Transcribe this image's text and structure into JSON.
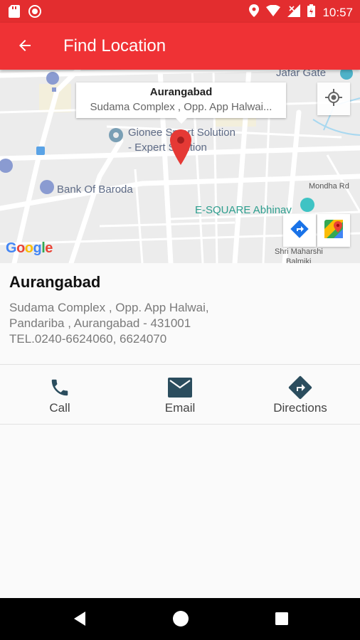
{
  "status_bar": {
    "time": "10:57",
    "left_icons": [
      "sd-card-icon",
      "record-icon"
    ],
    "right_icons": [
      "location-icon",
      "wifi-icon",
      "signal-icon",
      "battery-icon"
    ]
  },
  "app_bar": {
    "title": "Find Location",
    "back_icon": "arrow-back-icon",
    "color": "#ef3235"
  },
  "map": {
    "info_window": {
      "title": "Aurangabad",
      "subtitle": "Sudama Complex , Opp. App Halwai..."
    },
    "labels": {
      "jafar_gate": "Jafar Gate",
      "gionee_1": "Gionee Smart Solution",
      "gionee_2": "- Expert Solution",
      "bank": "Bank Of Baroda",
      "mondha": "Mondha Rd",
      "esquare": "E-SQUARE Abhinav",
      "shri_1": "Shri Maharshi",
      "shri_2": "Balmiki"
    },
    "logo": "Google",
    "marker_color": "#e53935"
  },
  "location": {
    "name": "Aurangabad",
    "address_line1": "Sudama Complex , Opp. App Halwai,",
    "address_line2": "Pandariba , Aurangabad - 431001",
    "phone_line": "TEL.0240-6624060, 6624070"
  },
  "actions": [
    {
      "label": "Call",
      "icon": "phone-icon"
    },
    {
      "label": "Email",
      "icon": "email-icon"
    },
    {
      "label": "Directions",
      "icon": "directions-icon"
    }
  ],
  "accent_color": "#2b4d5e",
  "nav_bar": {
    "icons": [
      "back-triangle-icon",
      "home-circle-icon",
      "recents-square-icon"
    ]
  }
}
